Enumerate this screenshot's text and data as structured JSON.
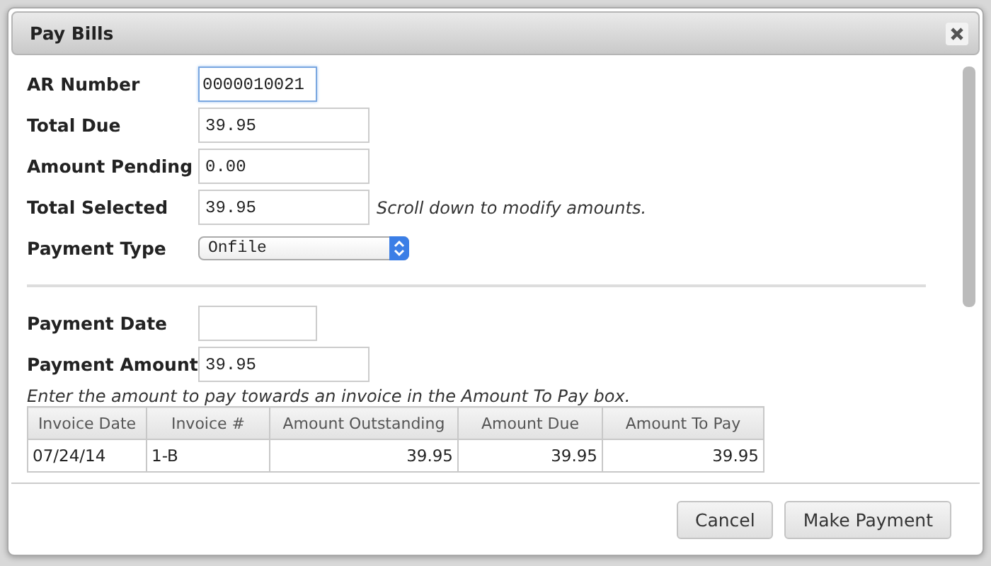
{
  "window": {
    "title": "Pay Bills"
  },
  "fields": [
    {
      "kind": "short_text",
      "label": "AR Number",
      "value": "0000010021",
      "focused": true
    },
    {
      "kind": "text",
      "label": "Total Due",
      "value": "39.95",
      "focused": false
    },
    {
      "kind": "text",
      "label": "Amount Pending",
      "value": "0.00",
      "focused": false
    },
    {
      "kind": "text",
      "label": "Total Selected",
      "value": "39.95",
      "focused": false,
      "note": "Scroll down to modify amounts."
    },
    {
      "kind": "select",
      "label": "Payment Type",
      "value": "Onfile",
      "focused": false
    }
  ],
  "payment_fields": [
    {
      "kind": "short_text",
      "label": "Payment Date",
      "focused": false
    },
    {
      "kind": "text",
      "label": "Payment Amount",
      "value": "39.95",
      "focused": false
    }
  ],
  "instructions": "Enter the amount to pay towards an invoice in the Amount To Pay box.",
  "table": {
    "columns": [
      "Invoice Date",
      "Invoice #",
      "Amount Outstanding",
      "Amount Due",
      "Amount To Pay"
    ],
    "rows": [
      [
        "07/24/14",
        "1-B",
        "39.95",
        "39.95",
        "39.95"
      ]
    ]
  },
  "buttons": [
    "Cancel",
    "Make Payment"
  ]
}
